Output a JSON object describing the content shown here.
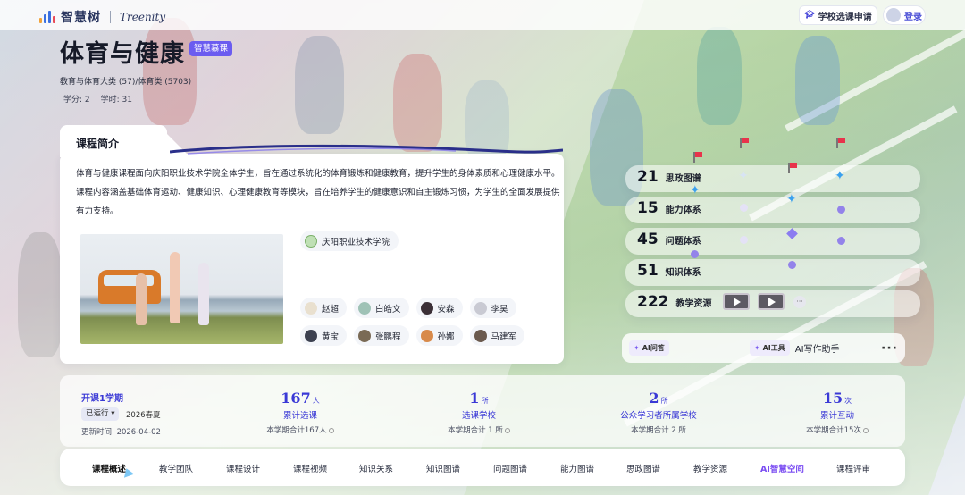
{
  "topbar": {
    "logo_text": "智慧树",
    "logo_sub": "Treenity",
    "apply_label": "学校选课申请",
    "login_label": "登录"
  },
  "course": {
    "title": "体育与健康",
    "badge": "智慧慕课",
    "category": "教育与体育大类 (57)/体育类 (5703)",
    "credit": "学分: 2",
    "hours": "学时: 31"
  },
  "intro": {
    "heading": "课程简介",
    "text": "体育与健康课程面向庆阳职业技术学院全体学生，旨在通过系统化的体育锻炼和健康教育，提升学生的身体素质和心理健康水平。课程内容涵盖基础体育运动、健康知识、心理健康教育等模块，旨在培养学生的健康意识和自主锻炼习惯，为学生的全面发展提供有力支持。",
    "school": "庆阳职业技术学院",
    "teachers": [
      "赵超",
      "白皓文",
      "安森",
      "李昊",
      "黄宝",
      "张鹏程",
      "孙娜",
      "马建军"
    ]
  },
  "graph": {
    "items": [
      {
        "num": "21",
        "label": "思政图谱"
      },
      {
        "num": "15",
        "label": "能力体系"
      },
      {
        "num": "45",
        "label": "问题体系"
      },
      {
        "num": "51",
        "label": "知识体系"
      },
      {
        "num": "222",
        "label": "教学资源"
      }
    ],
    "more": "···"
  },
  "ai_bar": {
    "chip1": "AI问答",
    "chip2": "AI工具",
    "helper": "AI写作助手",
    "more": "···"
  },
  "stats": {
    "term": "开课1学期",
    "status": "已运行 ▾",
    "season": "2026春夏",
    "updated": "更新时间: 2026-04-02",
    "items": [
      {
        "num": "167",
        "unit": "人",
        "label": "累计选课",
        "sub": "本学期合计167人"
      },
      {
        "num": "1",
        "unit": "所",
        "label": "选课学校",
        "sub": "本学期合计 1 所"
      },
      {
        "num": "2",
        "unit": "所",
        "label": "公众学习者所属学校",
        "sub": "本学期合计 2 所"
      },
      {
        "num": "15",
        "unit": "次",
        "label": "累计互动",
        "sub": "本学期合计15次"
      }
    ]
  },
  "tabs": [
    "课程概述",
    "教学团队",
    "课程设计",
    "课程视频",
    "知识关系",
    "知识图谱",
    "问题图谱",
    "能力图谱",
    "思政图谱",
    "教学资源",
    "AI智慧空间",
    "课程评审"
  ],
  "colors": {
    "accent": "#3a39d6",
    "ai_purple": "#7a4cf2",
    "badge": "#6b5cf0"
  }
}
